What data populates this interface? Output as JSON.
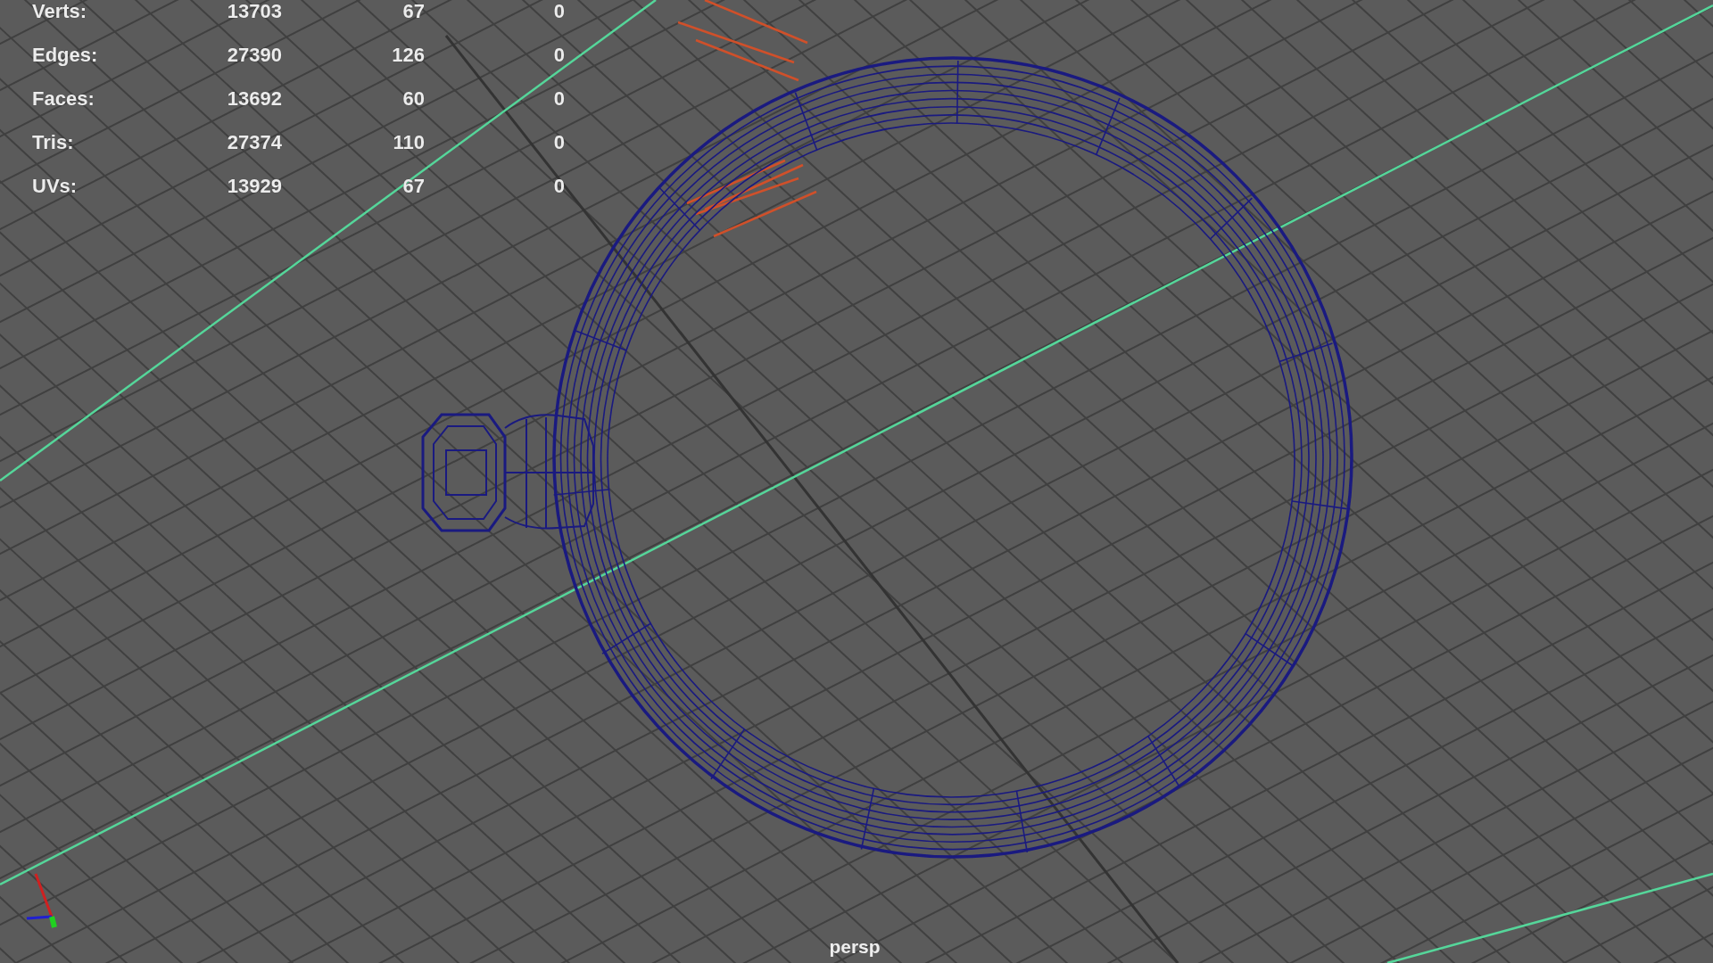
{
  "hud": {
    "rows": [
      {
        "label": "Verts:",
        "values": [
          "13703",
          "67",
          "0"
        ]
      },
      {
        "label": "Edges:",
        "values": [
          "27390",
          "126",
          "0"
        ]
      },
      {
        "label": "Faces:",
        "values": [
          "13692",
          "60",
          "0"
        ]
      },
      {
        "label": "Tris:",
        "values": [
          "27374",
          "110",
          "0"
        ]
      },
      {
        "label": "UVs:",
        "values": [
          "13929",
          "67",
          "0"
        ]
      }
    ]
  },
  "camera_label": "persp"
}
